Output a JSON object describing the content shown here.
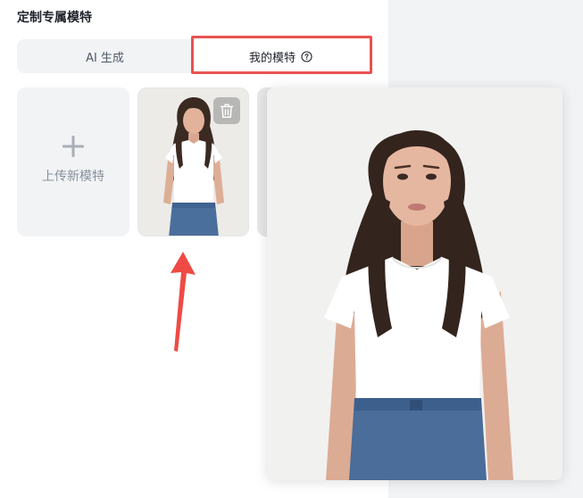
{
  "section": {
    "title": "定制专属模特"
  },
  "tabs": [
    {
      "label": "AI 生成",
      "active": false
    },
    {
      "label": "我的模特",
      "active": true,
      "icon": "help-circle-icon"
    }
  ],
  "upload": {
    "label": "上传新模特",
    "icon": "plus-icon"
  },
  "models": [
    {
      "name": "model-1",
      "action_icon": "trash-icon"
    }
  ],
  "colors": {
    "highlight": "#e8534f",
    "tab_bg": "#f2f3f5",
    "text_primary": "#1d2129",
    "text_secondary": "#86909c"
  }
}
